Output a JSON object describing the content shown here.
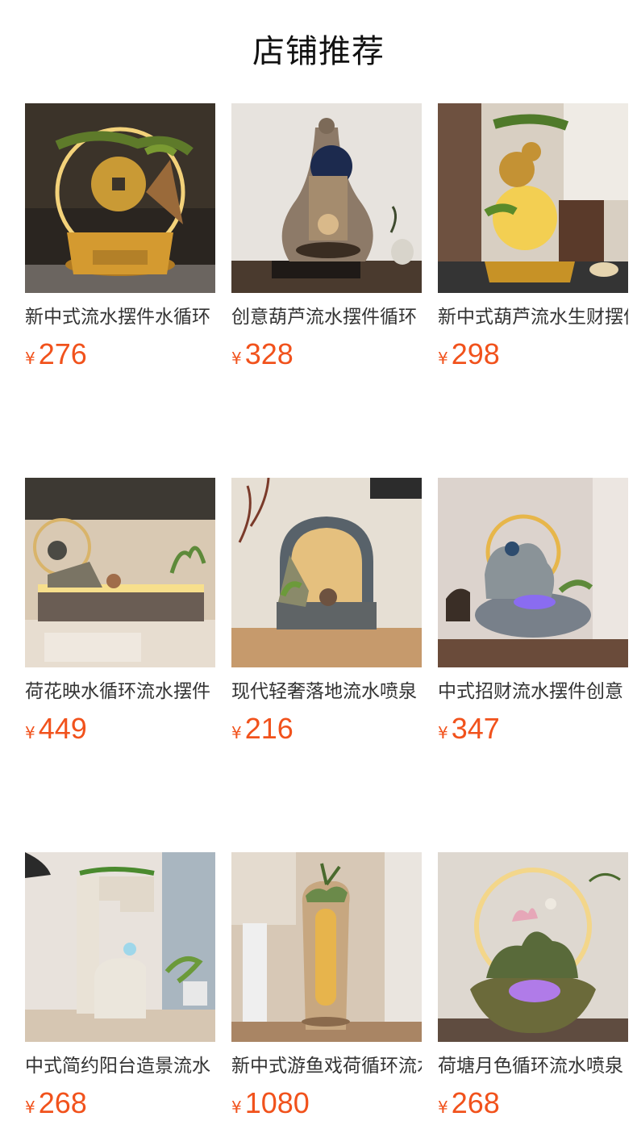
{
  "header": {
    "title": "店铺推荐"
  },
  "currency_symbol": "¥",
  "colors": {
    "price": "#f1521c",
    "text": "#333333",
    "title": "#111111"
  },
  "products": [
    {
      "name": "新中式流水摆件水循环",
      "price": "276",
      "icon": "fountain-pine-coin-image"
    },
    {
      "name": "创意葫芦流水摆件循环",
      "price": "328",
      "icon": "fountain-gourd-image"
    },
    {
      "name": "新中式葫芦流水生财摆件",
      "price": "298",
      "icon": "fountain-gourd-pine-image"
    },
    {
      "name": "荷花映水循环流水摆件",
      "price": "449",
      "icon": "fountain-lotus-long-image"
    },
    {
      "name": "现代轻奢落地流水喷泉",
      "price": "216",
      "icon": "fountain-round-screen-image"
    },
    {
      "name": "中式招财流水摆件创意",
      "price": "347",
      "icon": "fountain-stone-bowl-image"
    },
    {
      "name": "中式简约阳台造景流水",
      "price": "268",
      "icon": "fountain-white-stone-image"
    },
    {
      "name": "新中式游鱼戏荷循环流水",
      "price": "1080",
      "icon": "fountain-tall-vase-image"
    },
    {
      "name": "荷塘月色循环流水喷泉",
      "price": "268",
      "icon": "fountain-lotus-ring-image"
    }
  ]
}
